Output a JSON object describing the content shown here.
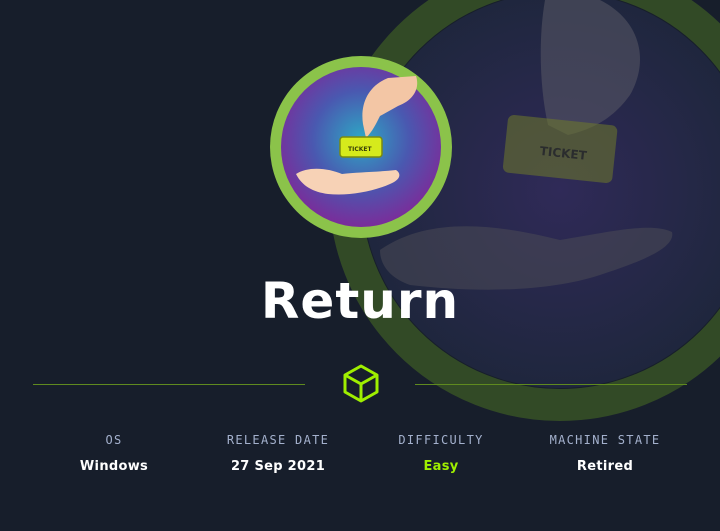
{
  "machine": {
    "name": "Return"
  },
  "ticket_text": "TICKET",
  "stats": [
    {
      "label": "OS",
      "value": "Windows"
    },
    {
      "label": "RELEASE DATE",
      "value": "27 Sep 2021"
    },
    {
      "label": "DIFFICULTY",
      "value": "Easy"
    },
    {
      "label": "MACHINE STATE",
      "value": "Retired"
    }
  ],
  "colors": {
    "background": "#171e2b",
    "accent": "#9fef00",
    "label": "#a4b1cd",
    "logo_ring": "#8bc34a"
  },
  "icons": [
    "hand-icon",
    "ticket-icon",
    "cube-icon"
  ]
}
